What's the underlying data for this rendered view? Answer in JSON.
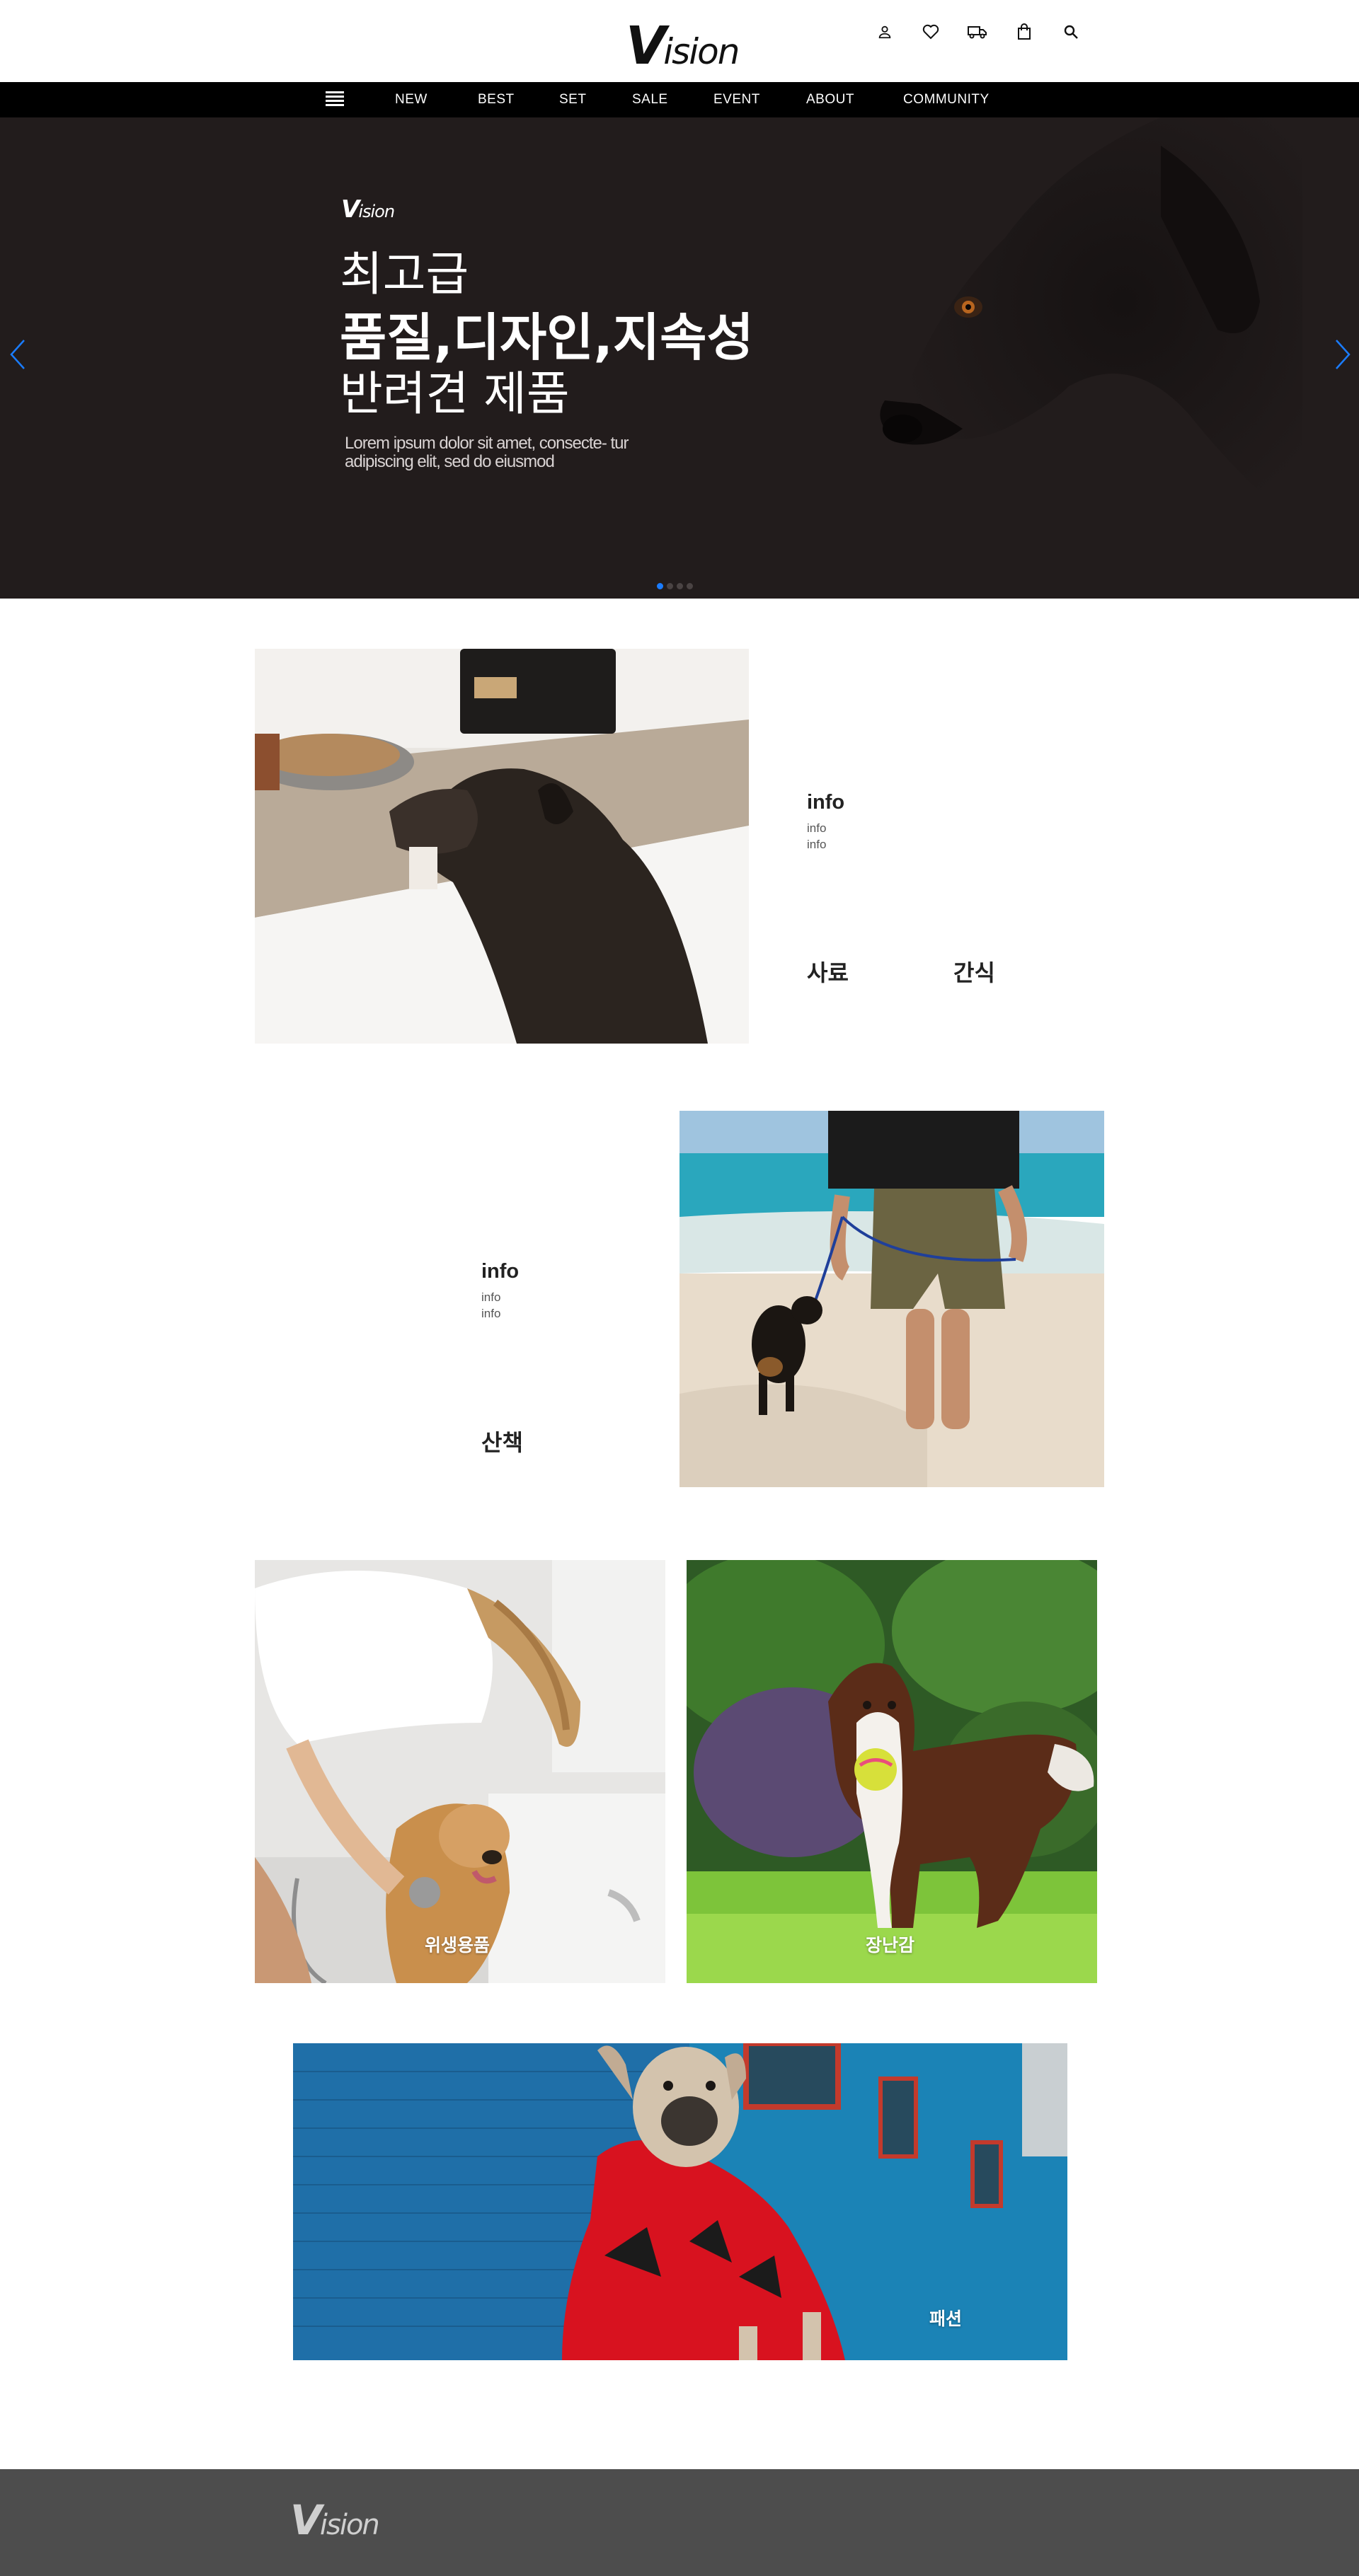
{
  "header": {
    "logo_initial": "V",
    "logo_rest": "ision",
    "icons": [
      "user-icon",
      "heart-icon",
      "truck-icon",
      "shopping-bag-icon",
      "search-icon"
    ]
  },
  "nav": {
    "menu_icon": "hamburger-menu-icon",
    "items": [
      "NEW",
      "BEST",
      "SET",
      "SALE",
      "EVENT",
      "ABOUT",
      "COMMUNITY"
    ]
  },
  "hero": {
    "logo_initial": "V",
    "logo_rest": "ision",
    "line1": "최고급",
    "line2": "품질,디자인,지속성",
    "line3": "반려견 제품",
    "subtitle": "Lorem ipsum dolor sit amet, consecte- tur adipiscing elit, sed do eiusmod",
    "slide_count": 4,
    "active_slide": 1,
    "accent_color": "#1a7cff",
    "background_color": "#221c1c"
  },
  "section1": {
    "info_title": "info",
    "info_lines": [
      "info",
      "info"
    ],
    "categories": [
      "사료",
      "간식"
    ]
  },
  "section2": {
    "info_title": "info",
    "info_lines": [
      "info",
      "info"
    ],
    "category": "산책"
  },
  "section3": {
    "cards": [
      {
        "caption": "위생용품"
      },
      {
        "caption": "장난감"
      }
    ]
  },
  "section4": {
    "caption": "패션"
  },
  "footer": {
    "logo_initial": "V",
    "logo_rest": "ision",
    "background_color": "#4d4d4d"
  }
}
